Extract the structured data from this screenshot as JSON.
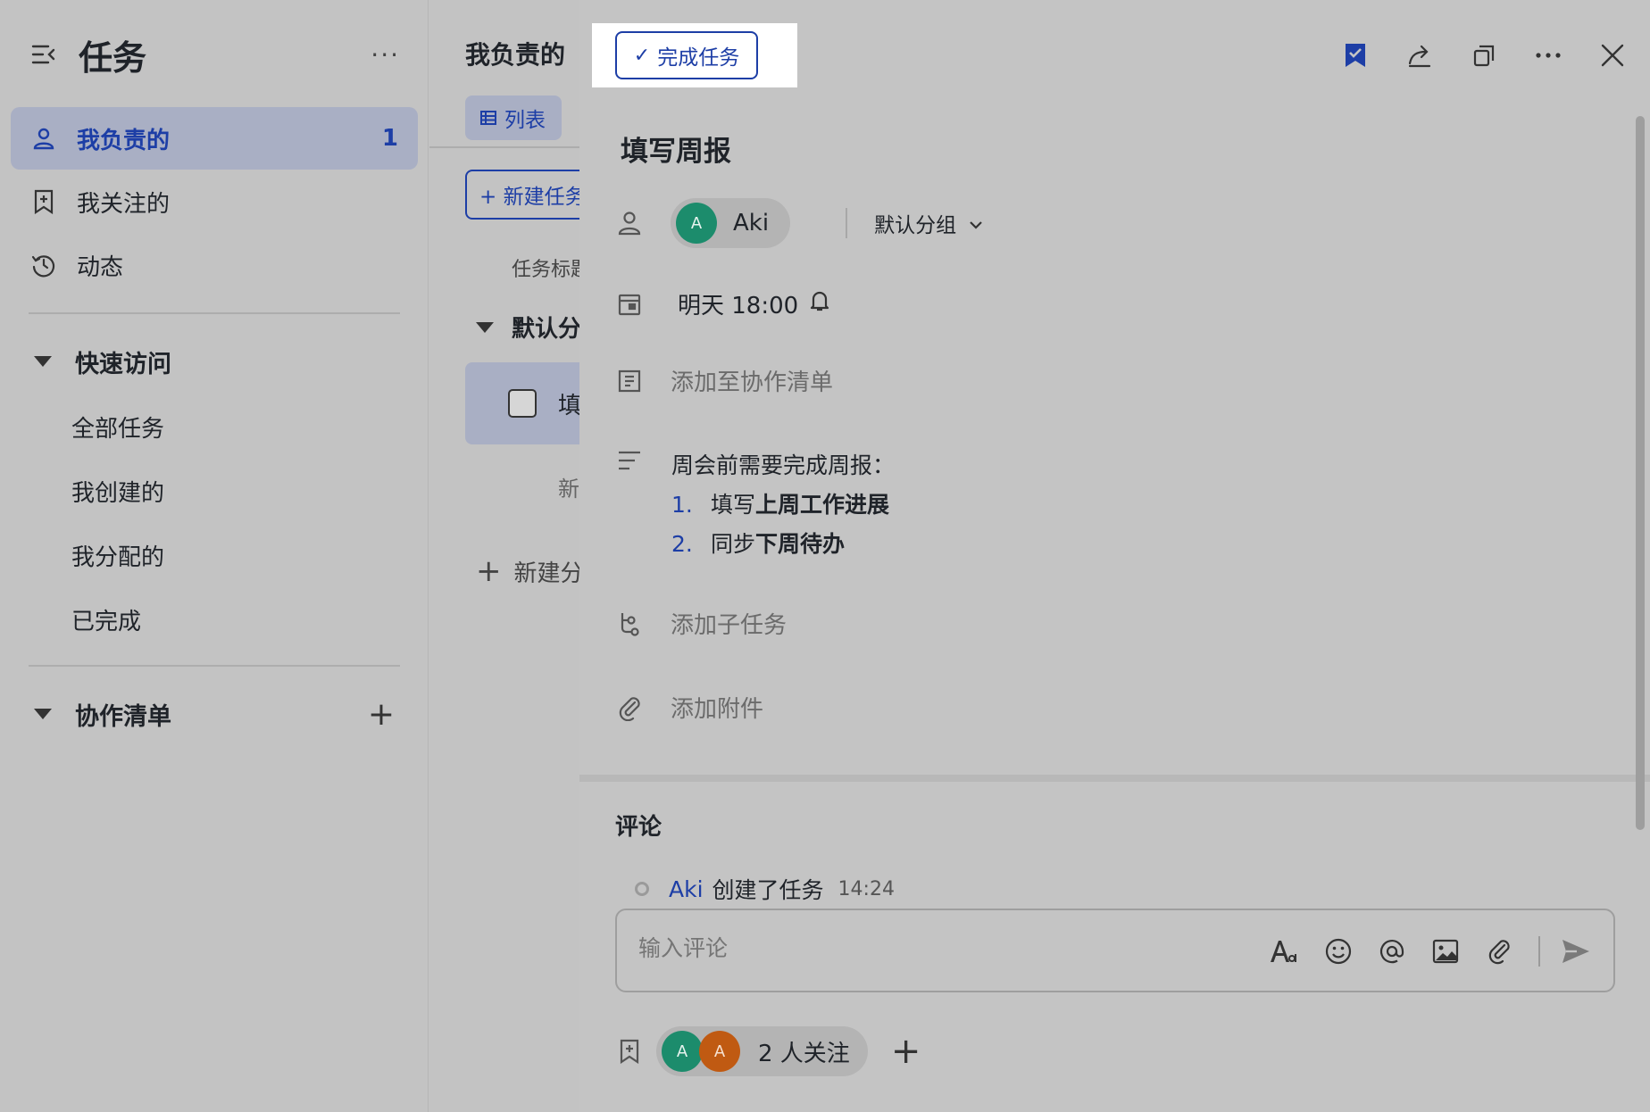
{
  "sidebar": {
    "title": "任务",
    "more": "···",
    "nav": [
      {
        "label": "我负责的",
        "count": "1"
      },
      {
        "label": "我关注的"
      },
      {
        "label": "动态"
      }
    ],
    "quick_access": {
      "label": "快速访问",
      "items": [
        "全部任务",
        "我创建的",
        "我分配的",
        "已完成"
      ]
    },
    "collab": {
      "label": "协作清单",
      "add": "+"
    }
  },
  "middle": {
    "title": "我负责的",
    "tab_list": "列表",
    "new_task": "+ 新建任务",
    "column_header": "任务标题",
    "group": "默认分组",
    "row_text": "填写周报",
    "new_inline": "新建任务",
    "new_group": "新建分组"
  },
  "detail": {
    "complete_label": "完成任务",
    "task_title": "填写周报",
    "assignee": {
      "initial": "A",
      "name": "Aki"
    },
    "group": "默认分组",
    "due": "明天 18:00",
    "add_collab_list": "添加至协作清单",
    "description": {
      "intro": "周会前需要完成周报：",
      "items": [
        {
          "num": "1.",
          "plain": "填写",
          "bold": "上周工作进展"
        },
        {
          "num": "2.",
          "plain": "同步",
          "bold": "下周待办"
        }
      ]
    },
    "add_subtask": "添加子任务",
    "add_attachment": "添加附件",
    "comments": {
      "title": "评论",
      "activity": {
        "who": "Aki",
        "action": "创建了任务",
        "time": "14:24"
      },
      "placeholder": "输入评论"
    },
    "followers": {
      "avatars": [
        "A",
        "A"
      ],
      "label": "2 人关注",
      "add": "+"
    }
  },
  "colors": {
    "accent": "#1d3ea6",
    "avatar_green": "#1c8c6c",
    "avatar_orange": "#c05a12",
    "overlay_gray": "#c4c4c4"
  }
}
